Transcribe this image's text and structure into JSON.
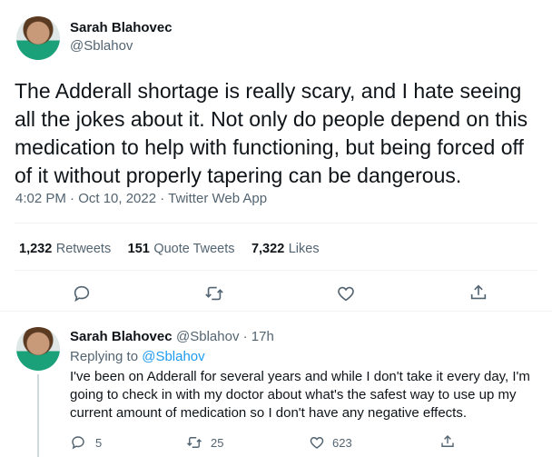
{
  "main_tweet": {
    "author_name": "Sarah Blahovec",
    "author_handle": "@Sblahov",
    "text": "The Adderall shortage is really scary, and I hate seeing all the jokes about it. Not only do people depend on this medication to help with functioning, but being forced off of it without properly tapering can be dangerous.",
    "timestamp": "4:02 PM · Oct 10, 2022 · Twitter Web App",
    "stats": {
      "retweets_count": "1,232",
      "retweets_label": "Retweets",
      "quotes_count": "151",
      "quotes_label": "Quote Tweets",
      "likes_count": "7,322",
      "likes_label": "Likes"
    },
    "actions": [
      "reply-icon",
      "retweet-icon",
      "like-icon",
      "share-icon"
    ]
  },
  "reply_tweet": {
    "author_name": "Sarah Blahovec",
    "author_handle_time": "@Sblahov · 17h",
    "replying_prefix": "Replying to",
    "replying_to": "@Sblahov",
    "text": "I've been on Adderall for several years and while I don't take it every day, I'm going to check in with my doctor about what's the safest way to use up my current amount of medication so I don't have any negative effects.",
    "reply_count": "5",
    "retweet_count": "25",
    "like_count": "623"
  },
  "colors": {
    "text": "#0f1419",
    "secondary": "#536471",
    "link": "#1d9bf0",
    "divider": "#eff3f4"
  }
}
